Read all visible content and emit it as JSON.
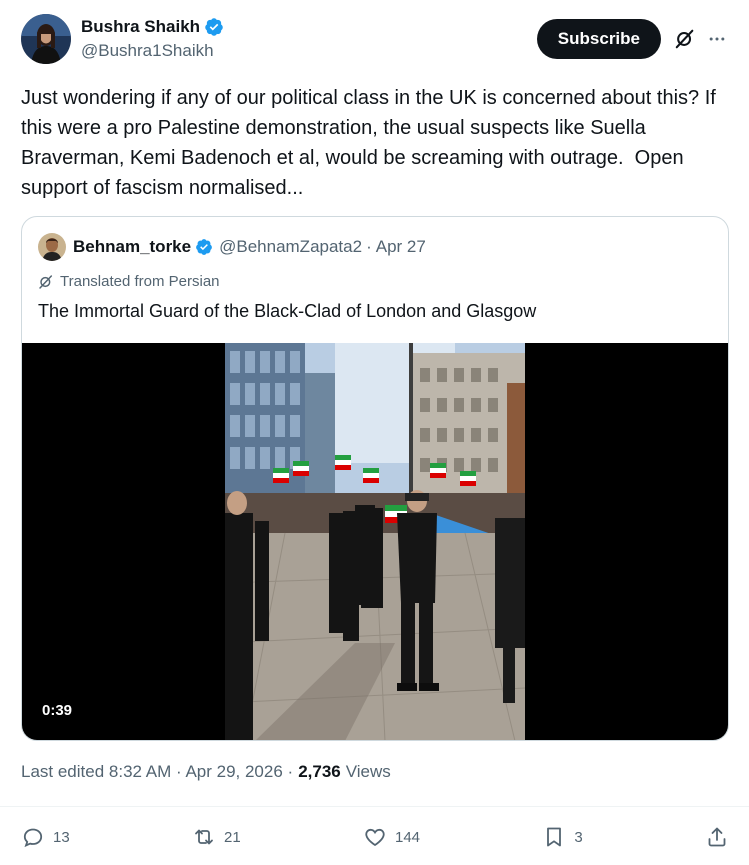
{
  "author": {
    "display_name": "Bushra Shaikh",
    "handle": "@Bushra1Shaikh",
    "verified": true
  },
  "header": {
    "subscribe_label": "Subscribe"
  },
  "tweet": {
    "text": "Just wondering if any of our political class in the UK is concerned about this? If this were a pro Palestine demonstration, the usual suspects like Suella Braverman, Kemi Badenoch et al, would be screaming with outrage.  Open support of fascism normalised..."
  },
  "quote": {
    "display_name": "Behnam_torke",
    "handle": "@BehnamZapata2",
    "separator": "·",
    "date": "Apr 27",
    "translated_label": "Translated from Persian",
    "text": "The Immortal Guard of the Black-Clad of London and Glasgow",
    "video_duration": "0:39"
  },
  "meta": {
    "edited_label": "Last edited 8:32 AM · Apr 29, 2026 ·",
    "views_count": "2,736",
    "views_label": "Views"
  },
  "actions": {
    "replies": "13",
    "reposts": "21",
    "likes": "144",
    "bookmarks": "3"
  },
  "colors": {
    "text": "#0f1419",
    "secondary": "#536471",
    "verified": "#1d9bf0",
    "border": "#cfd9de"
  }
}
